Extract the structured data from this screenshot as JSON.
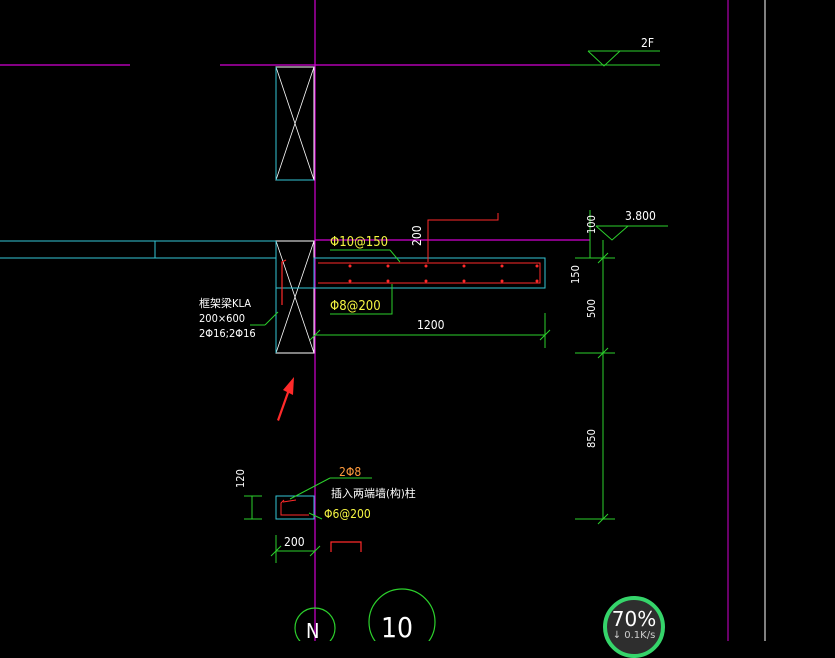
{
  "drawing": {
    "level_mark_2f": "2F",
    "level_mark_value": "3.800",
    "beam_top_rebar": "Φ10@150",
    "beam_stirrup": "Φ8@200",
    "beam_depth": "200",
    "canopy_length": "1200",
    "dim_100": "100",
    "dim_150": "150",
    "dim_500": "500",
    "dim_850": "850",
    "beam_label_line1": "框架梁KLA",
    "beam_label_line2": "200×600",
    "beam_label_line3": "2Φ16;2Φ16",
    "column_top_rebar": "2Φ8",
    "column_label": "插入两端墙(构)柱",
    "column_stirrup": "Φ6@200",
    "column_width": "200",
    "column_height": "120",
    "axis_n": "N",
    "axis_10": "10"
  },
  "status": {
    "percent": "70%",
    "rate": "↓ 0.1K/s"
  },
  "colors": {
    "magenta": "#d200d2",
    "cyan": "#33c6d6",
    "green": "#2cd02c",
    "yellow": "#f5f542",
    "red": "#ff2a2a",
    "white": "#ffffff"
  }
}
